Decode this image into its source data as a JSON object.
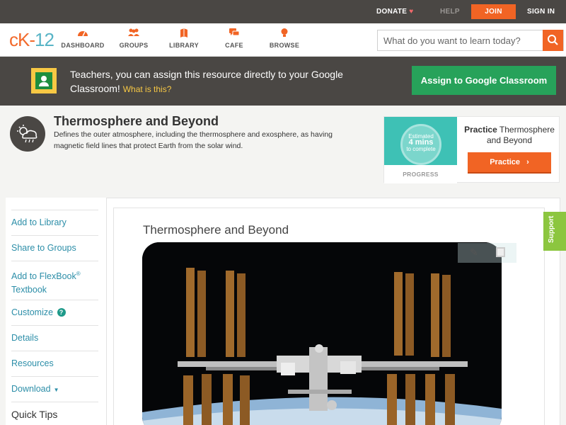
{
  "topbar": {
    "donate": "DONATE",
    "help": "HELP",
    "join": "JOIN",
    "signin": "SIGN IN"
  },
  "nav": {
    "items": [
      {
        "label": "DASHBOARD",
        "icon": "dashboard-icon"
      },
      {
        "label": "GROUPS",
        "icon": "groups-icon"
      },
      {
        "label": "LIBRARY",
        "icon": "library-icon"
      },
      {
        "label": "CAFE",
        "icon": "cafe-icon"
      },
      {
        "label": "BROWSE",
        "icon": "browse-icon"
      }
    ],
    "search_placeholder": "What do you want to learn today?"
  },
  "banner": {
    "text": "Teachers, you can assign this resource directly to your Google Classroom!",
    "what_link": "What is this?",
    "button": "Assign to Google Classroom"
  },
  "header": {
    "title": "Thermosphere and Beyond",
    "description": "Defines the outer atmosphere, including the thermosphere and exosphere, as having magnetic field lines that protect Earth from the solar wind."
  },
  "practice": {
    "estimated": "Estimated",
    "mins": "4 mins",
    "complete": "to complete",
    "progress_label": "PROGRESS",
    "title_bold": "Practice",
    "title_rest": "Thermosphere and Beyond",
    "button": "Practice"
  },
  "sidebar": {
    "add_library": "Add to Library",
    "share_groups": "Share to Groups",
    "add_flexbook": "Add to FlexBook",
    "flexbook_reg": "®",
    "flexbook_textbook": "Textbook",
    "customize": "Customize",
    "details": "Details",
    "resources": "Resources",
    "download": "Download",
    "quick_tips": "Quick Tips"
  },
  "main": {
    "title": "Thermosphere and Beyond"
  },
  "support": "Support",
  "colors": {
    "brand_orange": "#f16424",
    "dark_bar": "#4a4744",
    "google_green": "#27a25a",
    "link_blue": "#2c8ea8",
    "teal": "#3ec1b5",
    "support_green": "#8cc63f"
  }
}
